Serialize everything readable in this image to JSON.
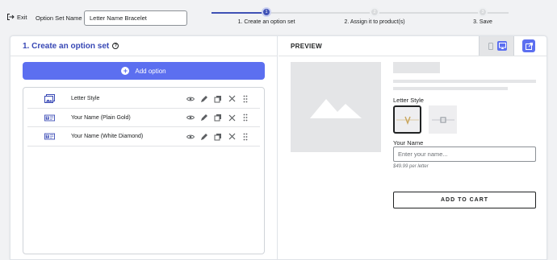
{
  "header": {
    "exit_label": "Exit",
    "option_set_label": "Option Set Name",
    "option_set_name": "Letter Name Bracelet"
  },
  "stepper": {
    "steps": [
      {
        "number": "1",
        "label": "1. Create an option set",
        "state": "active"
      },
      {
        "number": "2",
        "label": "2. Assign it to product(s)",
        "state": "pending"
      },
      {
        "number": "3",
        "label": "3. Save",
        "state": "pending"
      }
    ]
  },
  "left_panel": {
    "title": "1. Create an option set",
    "help_icon": "question-circle-icon",
    "add_option_label": "Add option",
    "options": [
      {
        "label": "Letter Style",
        "icon": "image-swatch-icon"
      },
      {
        "label": "Your Name (Plain Gold)",
        "icon": "text-field-icon"
      },
      {
        "label": "Your Name (White Diamond)",
        "icon": "text-field-icon"
      }
    ],
    "row_actions": [
      "eye-icon",
      "edit-pencil-icon",
      "duplicate-icon",
      "delete-x-icon",
      "drag-handle-icon"
    ]
  },
  "preview": {
    "title": "PREVIEW",
    "letter_style_label": "Letter Style",
    "your_name_label": "Your Name",
    "your_name_placeholder": "Enter your name...",
    "price_note": "$49.99 per letter",
    "add_to_cart_label": "ADD TO CART",
    "device_mode": "desktop"
  },
  "colors": {
    "accent": "#5c6ff0",
    "title_blue": "#3848b5",
    "stepper_active": "#3f51b5",
    "placeholder_gray": "#e4e5e7"
  }
}
